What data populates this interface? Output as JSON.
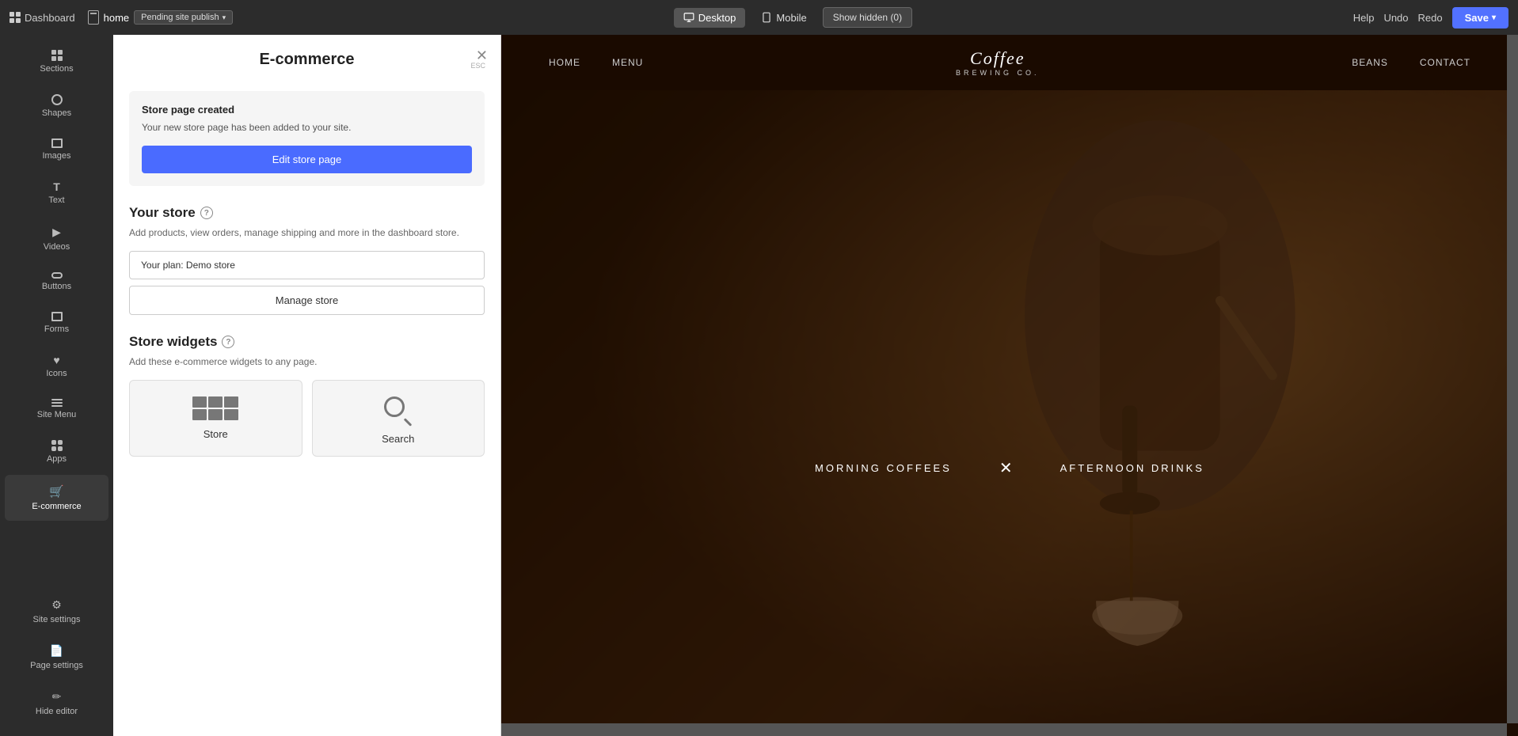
{
  "topbar": {
    "dashboard_label": "Dashboard",
    "page_label": "home",
    "pending_label": "Pending site publish",
    "view_desktop": "Desktop",
    "view_mobile": "Mobile",
    "show_hidden": "Show hidden (0)",
    "help": "Help",
    "undo": "Undo",
    "redo": "Redo",
    "save": "Save"
  },
  "sidebar": {
    "items": [
      {
        "id": "sections",
        "label": "Sections",
        "icon": "grid"
      },
      {
        "id": "shapes",
        "label": "Shapes",
        "icon": "circle"
      },
      {
        "id": "images",
        "label": "Images",
        "icon": "image"
      },
      {
        "id": "text",
        "label": "Text",
        "icon": "T"
      },
      {
        "id": "videos",
        "label": "Videos",
        "icon": "play"
      },
      {
        "id": "buttons",
        "label": "Buttons",
        "icon": "btn"
      },
      {
        "id": "forms",
        "label": "Forms",
        "icon": "form"
      },
      {
        "id": "icons",
        "label": "Icons",
        "icon": "heart"
      },
      {
        "id": "sitemenu",
        "label": "Site Menu",
        "icon": "menu"
      },
      {
        "id": "apps",
        "label": "Apps",
        "icon": "apps"
      },
      {
        "id": "ecommerce",
        "label": "E-commerce",
        "icon": "cart",
        "active": true
      }
    ],
    "bottom": [
      {
        "id": "site-settings",
        "label": "Site settings",
        "icon": "settings"
      },
      {
        "id": "page-settings",
        "label": "Page settings",
        "icon": "page"
      },
      {
        "id": "hide-editor",
        "label": "Hide editor",
        "icon": "eye"
      }
    ]
  },
  "panel": {
    "title": "E-commerce",
    "close_esc": "ESC",
    "store_created": {
      "title": "Store page created",
      "description": "Your new store page has been added to your site.",
      "edit_btn": "Edit store page"
    },
    "your_store": {
      "title": "Your store",
      "description": "Add products, view orders, manage shipping and more in the dashboard store.",
      "plan_label": "Your plan: Demo store",
      "manage_btn": "Manage store"
    },
    "store_widgets": {
      "title": "Store widgets",
      "description": "Add these e-commerce widgets to any page.",
      "widgets": [
        {
          "id": "store",
          "label": "Store"
        },
        {
          "id": "search",
          "label": "Search"
        }
      ]
    }
  },
  "preview": {
    "nav": {
      "links_left": [
        "HOME",
        "MENU"
      ],
      "logo_line1": "Coffee",
      "logo_line2": "BREWING CO.",
      "links_right": [
        "BEANS",
        "CONTACT"
      ]
    },
    "hero": {
      "tab1": "MORNING COFFEES",
      "separator": "✕",
      "tab2": "AFTERNOON DRINKS"
    }
  }
}
